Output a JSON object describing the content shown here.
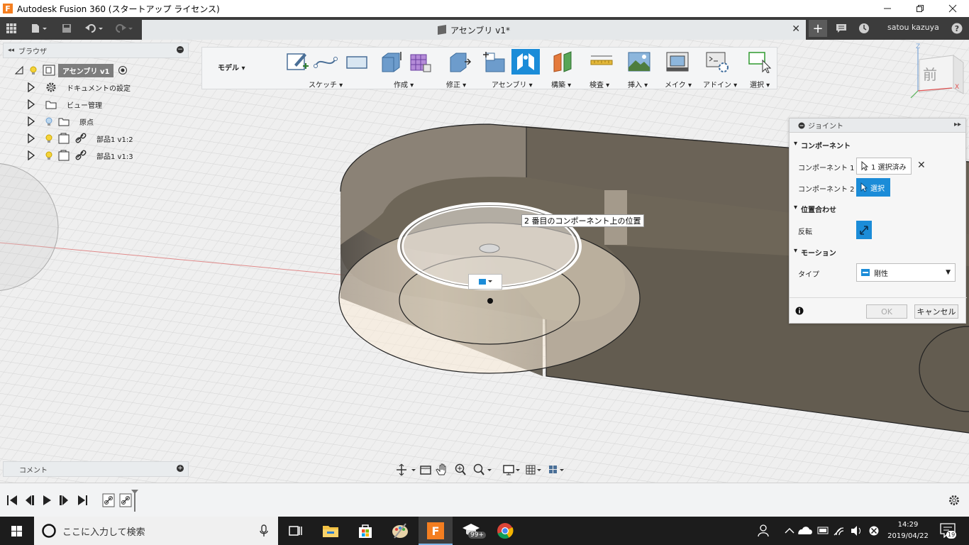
{
  "window": {
    "title": "Autodesk Fusion 360 (スタートアップ ライセンス)",
    "app_logo": "F"
  },
  "doc_tab": {
    "title": "アセンブリ v1*"
  },
  "user": {
    "name": "satou kazuya"
  },
  "browser": {
    "title": "ブラウザ",
    "root": "アセンブリ v1",
    "items": [
      {
        "label": "ドキュメントの設定",
        "icon": "gear-icon"
      },
      {
        "label": "ビュー管理",
        "icon": "folder-icon"
      },
      {
        "label": "原点",
        "icon": "folder-icon"
      },
      {
        "label": "部品1 v1:2",
        "icon": "component-icon"
      },
      {
        "label": "部品1 v1:3",
        "icon": "component-icon"
      }
    ]
  },
  "ribbon": {
    "mode": "モデル",
    "groups": [
      {
        "label": "スケッチ ▾"
      },
      {
        "label": "作成 ▾"
      },
      {
        "label": "修正 ▾"
      },
      {
        "label": "アセンブリ ▾"
      },
      {
        "label": "構築 ▾"
      },
      {
        "label": "検査 ▾"
      },
      {
        "label": "挿入 ▾"
      },
      {
        "label": "メイク ▾"
      },
      {
        "label": "アドイン ▾"
      },
      {
        "label": "選択 ▾"
      }
    ]
  },
  "viewcube": {
    "face": "前",
    "axis_z": "Z",
    "axis_x": "X"
  },
  "viewport": {
    "tooltip": "2 番目のコンポーネント上の位置"
  },
  "joint_dialog": {
    "title": "ジョイント",
    "component_section": "コンポーネント",
    "component1_label": "コンポーネント 1",
    "component1_value": "1 選択済み",
    "component2_label": "コンポーネント 2",
    "component2_value": "選択",
    "alignment_section": "位置合わせ",
    "flip_label": "反転",
    "motion_section": "モーション",
    "type_label": "タイプ",
    "type_value": "剛性",
    "ok": "OK",
    "cancel": "キャンセル"
  },
  "comments": {
    "title": "コメント"
  },
  "taskbar": {
    "search_placeholder": "ここに入力して検索",
    "time": "14:29",
    "date": "2019/04/22",
    "notif_count": "19",
    "badge": "99+"
  },
  "colors": {
    "accent": "#1b8cd8",
    "brand": "#f47e20",
    "part": "#6e6658"
  }
}
